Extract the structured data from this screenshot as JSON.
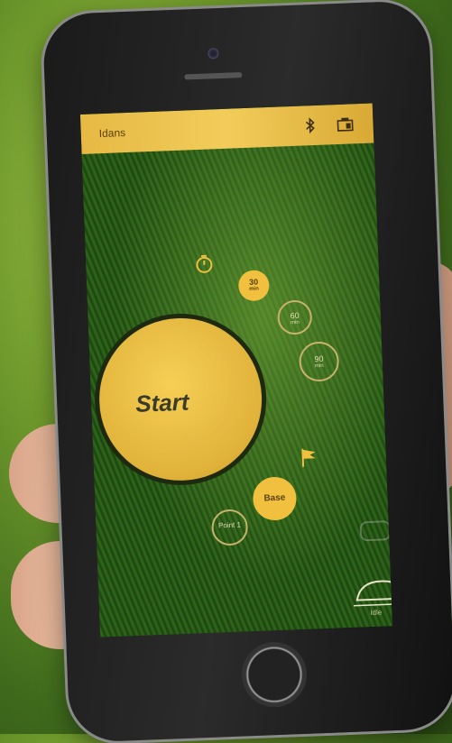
{
  "app": {
    "mower_name": "Idans",
    "start_label": "Start",
    "timer_options": [
      {
        "value": "30",
        "unit": "min"
      },
      {
        "value": "60",
        "unit": "min"
      },
      {
        "value": "90",
        "unit": "min"
      }
    ],
    "base_label": "Base",
    "point_label": "Point 1",
    "status_label": "Idle",
    "icons": {
      "bluetooth": "bluetooth-icon",
      "battery": "battery-icon",
      "timer": "timer-icon",
      "flag": "flag-icon",
      "settings": "settings-icon",
      "mower": "mower-icon"
    },
    "colors": {
      "accent_yellow": "#f0c03e",
      "grass_green": "#2f6a1a"
    }
  }
}
